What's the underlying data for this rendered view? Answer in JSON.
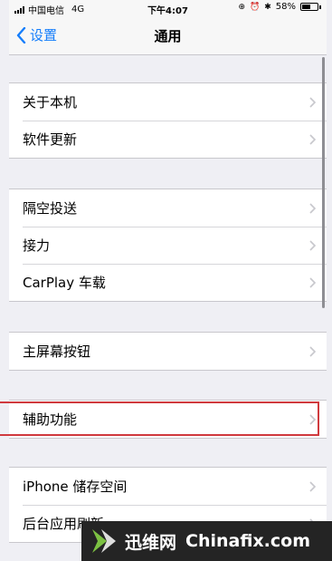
{
  "status_bar": {
    "carrier": "中国电信",
    "network": "4G",
    "time": "下午4:07",
    "battery": "58%",
    "battery_level": 0.58
  },
  "nav": {
    "back_label": "设置",
    "title": "通用"
  },
  "groups": [
    {
      "items": [
        {
          "label": "关于本机"
        },
        {
          "label": "软件更新"
        }
      ]
    },
    {
      "items": [
        {
          "label": "隔空投送"
        },
        {
          "label": "接力"
        },
        {
          "label": "CarPlay 车载"
        }
      ]
    },
    {
      "items": [
        {
          "label": "主屏幕按钮"
        }
      ]
    },
    {
      "items": [
        {
          "label": "辅助功能",
          "highlighted": true
        }
      ]
    },
    {
      "items": [
        {
          "label": "iPhone 储存空间"
        },
        {
          "label": "后台应用刷新"
        }
      ]
    }
  ],
  "watermark": {
    "brand": "迅维网",
    "site": "Chinafix.com"
  },
  "colors": {
    "accent": "#157efb",
    "highlight": "#d03a3e",
    "background": "#efeff4"
  }
}
